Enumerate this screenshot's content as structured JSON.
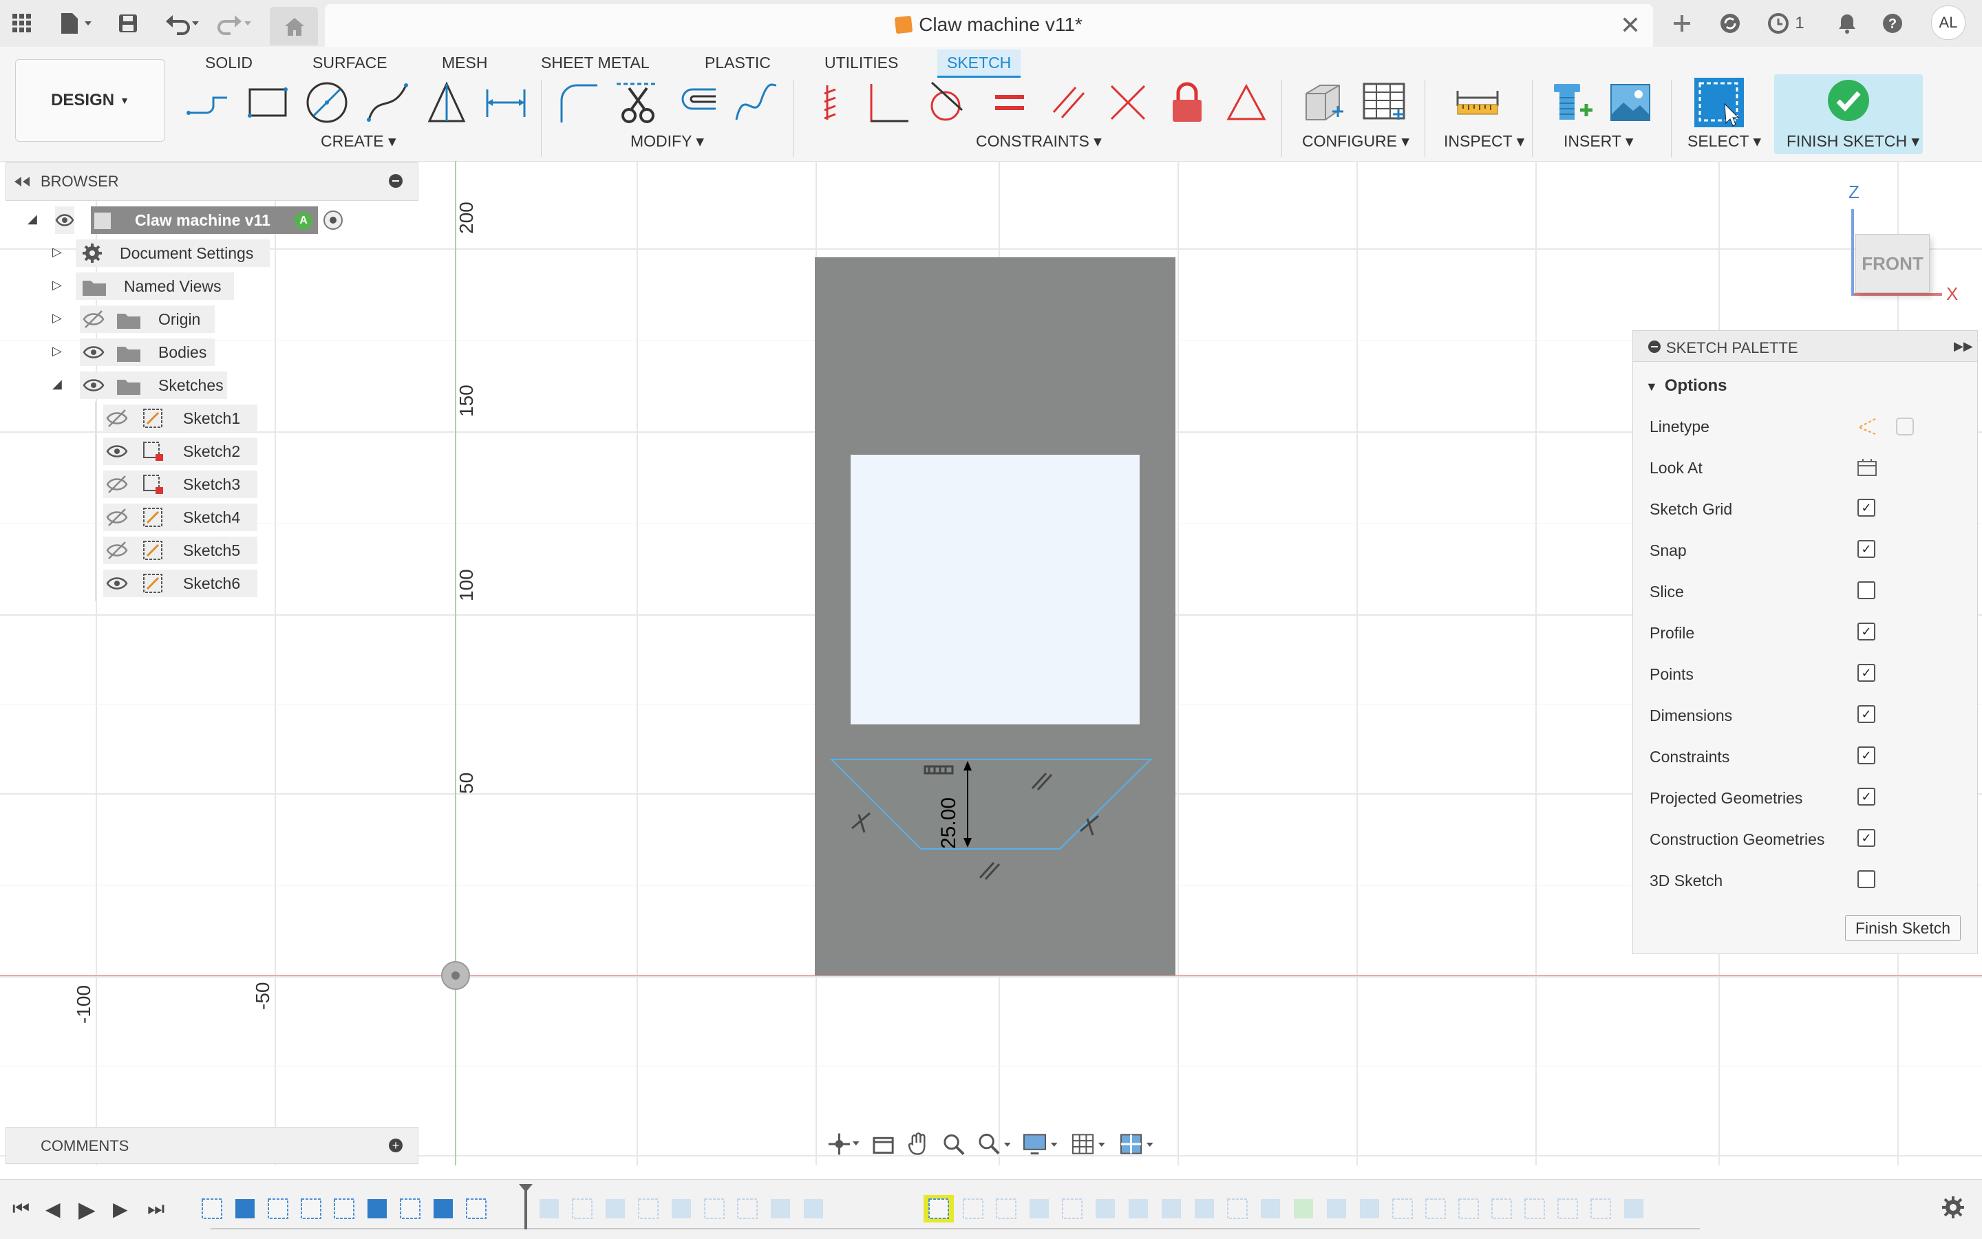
{
  "titlebar": {
    "doc_title": "Claw machine v11*",
    "notifications_count": "1",
    "user_initials": "AL",
    "close_tab_icon": "close-icon"
  },
  "toolbar": {
    "design_label": "DESIGN",
    "tabs": [
      "SOLID",
      "SURFACE",
      "MESH",
      "SHEET METAL",
      "PLASTIC",
      "UTILITIES",
      "SKETCH"
    ],
    "active_tab": "SKETCH",
    "groups": {
      "create": "CREATE",
      "modify": "MODIFY",
      "constraints": "CONSTRAINTS",
      "configure": "CONFIGURE",
      "inspect": "INSPECT",
      "insert": "INSERT",
      "select": "SELECT",
      "finish": "FINISH SKETCH"
    },
    "accent_color": "#1e88d2"
  },
  "browser": {
    "title": "BROWSER",
    "root": "Claw machine v11",
    "items": [
      {
        "label": "Document Settings",
        "icon": "gear-icon"
      },
      {
        "label": "Named Views",
        "icon": "folder-icon"
      },
      {
        "label": "Origin",
        "icon": "folder-icon"
      },
      {
        "label": "Bodies",
        "icon": "folder-icon"
      },
      {
        "label": "Sketches",
        "icon": "folder-icon"
      }
    ],
    "sketches": [
      "Sketch1",
      "Sketch2",
      "Sketch3",
      "Sketch4",
      "Sketch5",
      "Sketch6"
    ]
  },
  "canvas": {
    "ruler_labels": [
      "200",
      "150",
      "100",
      "50",
      "-100",
      "-50"
    ],
    "dimension_value": "25.00",
    "viewcube_face": "FRONT",
    "axis_z": "Z",
    "axis_x": "X"
  },
  "sketch_palette": {
    "title": "SKETCH PALETTE",
    "section": "Options",
    "rows": [
      {
        "label": "Linetype",
        "type": "icons"
      },
      {
        "label": "Look At",
        "type": "icon"
      },
      {
        "label": "Sketch Grid",
        "checked": true
      },
      {
        "label": "Snap",
        "checked": true
      },
      {
        "label": "Slice",
        "checked": false
      },
      {
        "label": "Profile",
        "checked": true
      },
      {
        "label": "Points",
        "checked": true
      },
      {
        "label": "Dimensions",
        "checked": true
      },
      {
        "label": "Constraints",
        "checked": true
      },
      {
        "label": "Projected Geometries",
        "checked": true
      },
      {
        "label": "Construction Geometries",
        "checked": true
      },
      {
        "label": "3D Sketch",
        "checked": false
      }
    ],
    "finish_button": "Finish Sketch"
  },
  "comments": {
    "title": "COMMENTS"
  }
}
